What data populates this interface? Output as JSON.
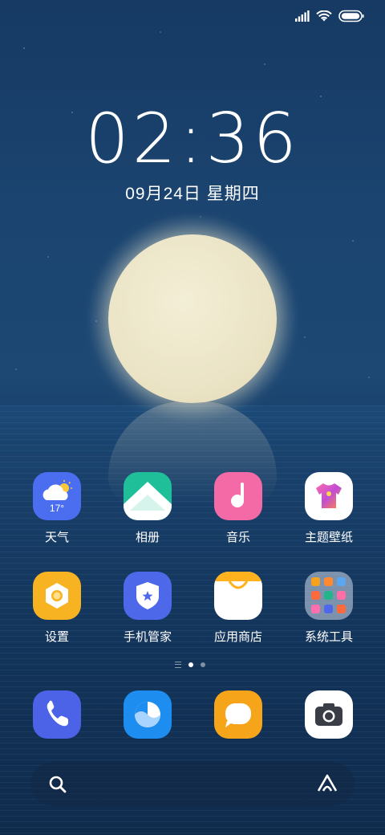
{
  "status_bar": {
    "signal_icon": "signal-bars-icon",
    "wifi_icon": "wifi-icon",
    "battery_icon": "battery-icon"
  },
  "lock": {
    "time": "02:36",
    "date": "09月24日  星期四"
  },
  "apps_row1": [
    {
      "label": "天气",
      "icon": "weather-icon",
      "temp": "17°"
    },
    {
      "label": "相册",
      "icon": "gallery-icon"
    },
    {
      "label": "音乐",
      "icon": "music-icon"
    },
    {
      "label": "主题壁纸",
      "icon": "theme-icon"
    }
  ],
  "apps_row2": [
    {
      "label": "设置",
      "icon": "settings-icon"
    },
    {
      "label": "手机管家",
      "icon": "security-icon"
    },
    {
      "label": "应用商店",
      "icon": "app-store-icon"
    },
    {
      "label": "系统工具",
      "icon": "system-tools-folder-icon"
    }
  ],
  "page_indicator": {
    "pages": 2,
    "active": 1
  },
  "dock": [
    {
      "icon": "phone-icon"
    },
    {
      "icon": "browser-icon"
    },
    {
      "icon": "messages-icon"
    },
    {
      "icon": "camera-icon"
    }
  ],
  "search": {
    "search_icon": "search-icon",
    "assistant_icon": "assistant-icon"
  },
  "colors": {
    "weather": "#4b6ef0",
    "gallery": "#1fbf9a",
    "music": "#f36aa7",
    "theme": "#ffffff",
    "settings": "#f7b322",
    "security": "#4d68e8",
    "app_store": "#ffffff",
    "phone": "#4c63e8",
    "browser": "#1e8df0",
    "messages": "#f6a51a",
    "camera": "#ffffff"
  }
}
